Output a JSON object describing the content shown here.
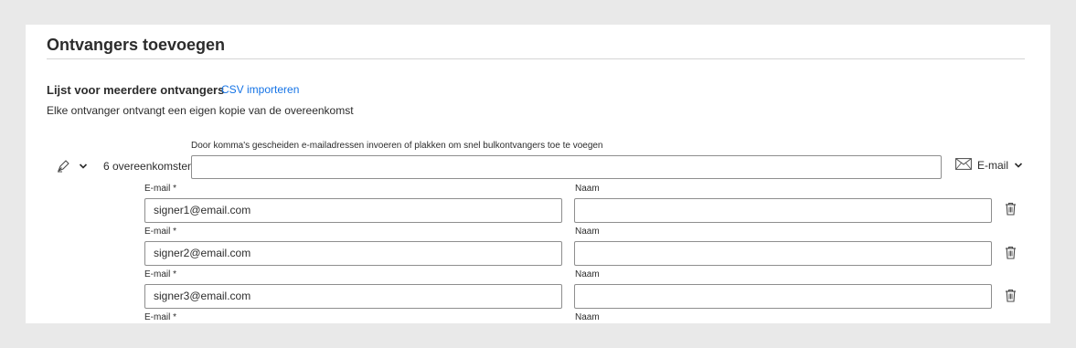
{
  "header": {
    "title": "Ontvangers toevoegen"
  },
  "multi_recipient": {
    "heading": "Lijst voor meerdere ontvangers",
    "csv_link": "CSV importeren",
    "description": "Elke ontvanger ontvangt een eigen kopie van de overeenkomst",
    "bulk_hint": "Door komma's gescheiden e-mailadressen invoeren of plakken om snel bulkontvangers toe te voegen",
    "agreement_count": "6 overeenkomsten",
    "bulk_input_value": "",
    "delivery_method": "E-mail"
  },
  "recipients": [
    {
      "email_label": "E-mail",
      "required_mark": "*",
      "email": "signer1@email.com",
      "name_label": "Naam",
      "name": ""
    },
    {
      "email_label": "E-mail",
      "required_mark": "*",
      "email": "signer2@email.com",
      "name_label": "Naam",
      "name": ""
    },
    {
      "email_label": "E-mail",
      "required_mark": "*",
      "email": "signer3@email.com",
      "name_label": "Naam",
      "name": ""
    },
    {
      "email_label": "E-mail",
      "required_mark": "*",
      "name_label": "Naam"
    }
  ],
  "icons": {
    "signer_role": "pen-icon",
    "role_dropdown": "chevron-down-icon",
    "delivery": "envelope-icon",
    "delivery_dropdown": "chevron-down-icon",
    "delete": "trash-icon"
  },
  "colors": {
    "link": "#1473e6",
    "background": "#e9e9e9",
    "panel": "#ffffff",
    "border": "#8e8e8e"
  }
}
